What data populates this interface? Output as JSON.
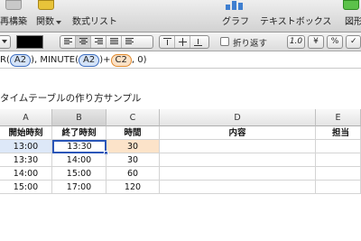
{
  "toolbar": {
    "insert_sort_label": "再構築",
    "functions_label": "関数",
    "formula_list_label": "数式リスト",
    "chart_label": "グラフ",
    "textbox_label": "テキストボックス",
    "shapes_label": "図形",
    "icons": [
      "sort-icon",
      "function-icon",
      "chart-icon",
      "shapes-icon"
    ]
  },
  "formatbar": {
    "wrap_label": "折り返す",
    "decimal_label": "1.0",
    "currency_label": "¥",
    "percent_label": "%",
    "text_color": "#000000"
  },
  "formula": {
    "prefix": "R(",
    "ref1": "A2",
    "mid": "), MINUTE(",
    "ref2": "A2",
    "plus": ")+",
    "ref3": "C2",
    "suffix": ", 0)"
  },
  "sheet": {
    "title": "タイムテーブルの作り方サンプル",
    "columns": [
      "A",
      "B",
      "C",
      "D",
      "E"
    ],
    "headers": [
      "開始時刻",
      "終了時刻",
      "時間",
      "内容",
      "担当"
    ],
    "rows": [
      [
        "13:00",
        "13:30",
        "30",
        "",
        ""
      ],
      [
        "13:30",
        "14:00",
        "30",
        "",
        ""
      ],
      [
        "14:00",
        "15:00",
        "60",
        "",
        ""
      ],
      [
        "15:00",
        "17:00",
        "120",
        "",
        ""
      ]
    ]
  },
  "colors": {
    "ref_blue": "#3f6fc0",
    "ref_orange": "#e08a2e",
    "selection": "#2a56b8"
  }
}
